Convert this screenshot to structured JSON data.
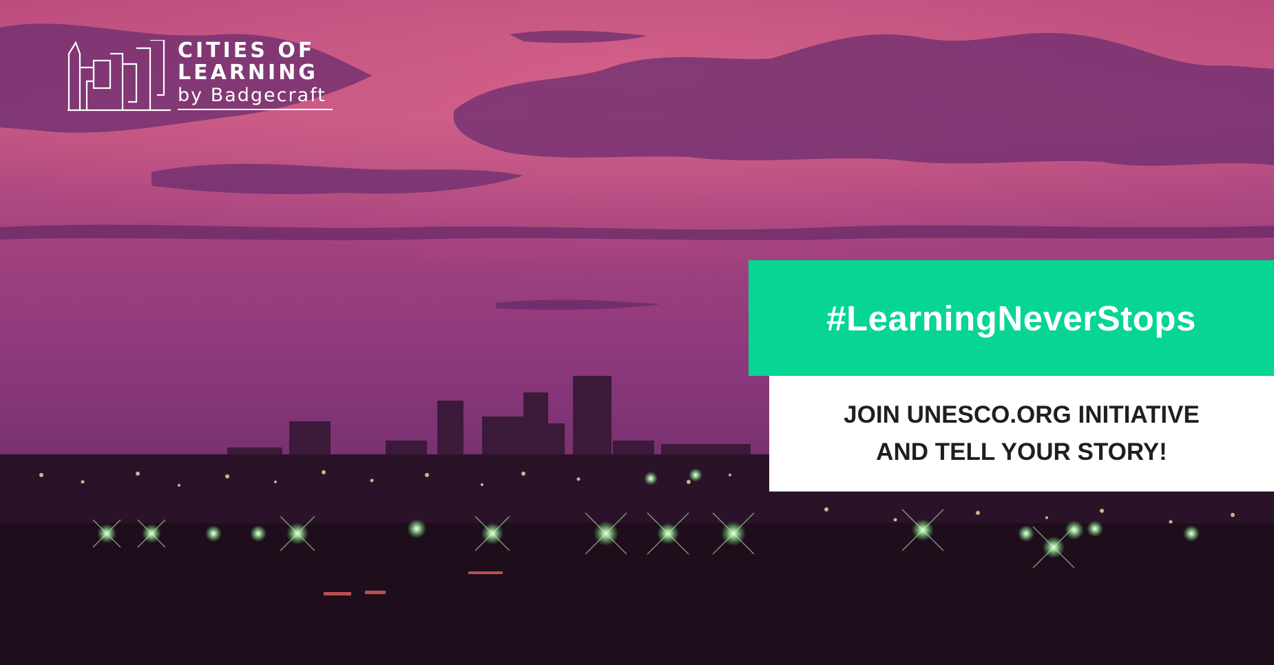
{
  "logo": {
    "line1": "CITIES OF",
    "line2": "LEARNING",
    "line3": "by Badgecraft",
    "icon": "city-skyline-outline-icon"
  },
  "banner": {
    "hashtag": "#LearningNeverStops",
    "cta_line1": "JOIN UNESCO.ORG INITIATIVE",
    "cta_line2": "AND TELL YOUR STORY!"
  },
  "colors": {
    "hashtag_bg": "#07d593",
    "cta_bg": "#ffffff",
    "cta_text": "#1f1f1f",
    "sky_top": "#c2517a",
    "sky_mid": "#8e3a7e",
    "ground": "#2b1527"
  }
}
